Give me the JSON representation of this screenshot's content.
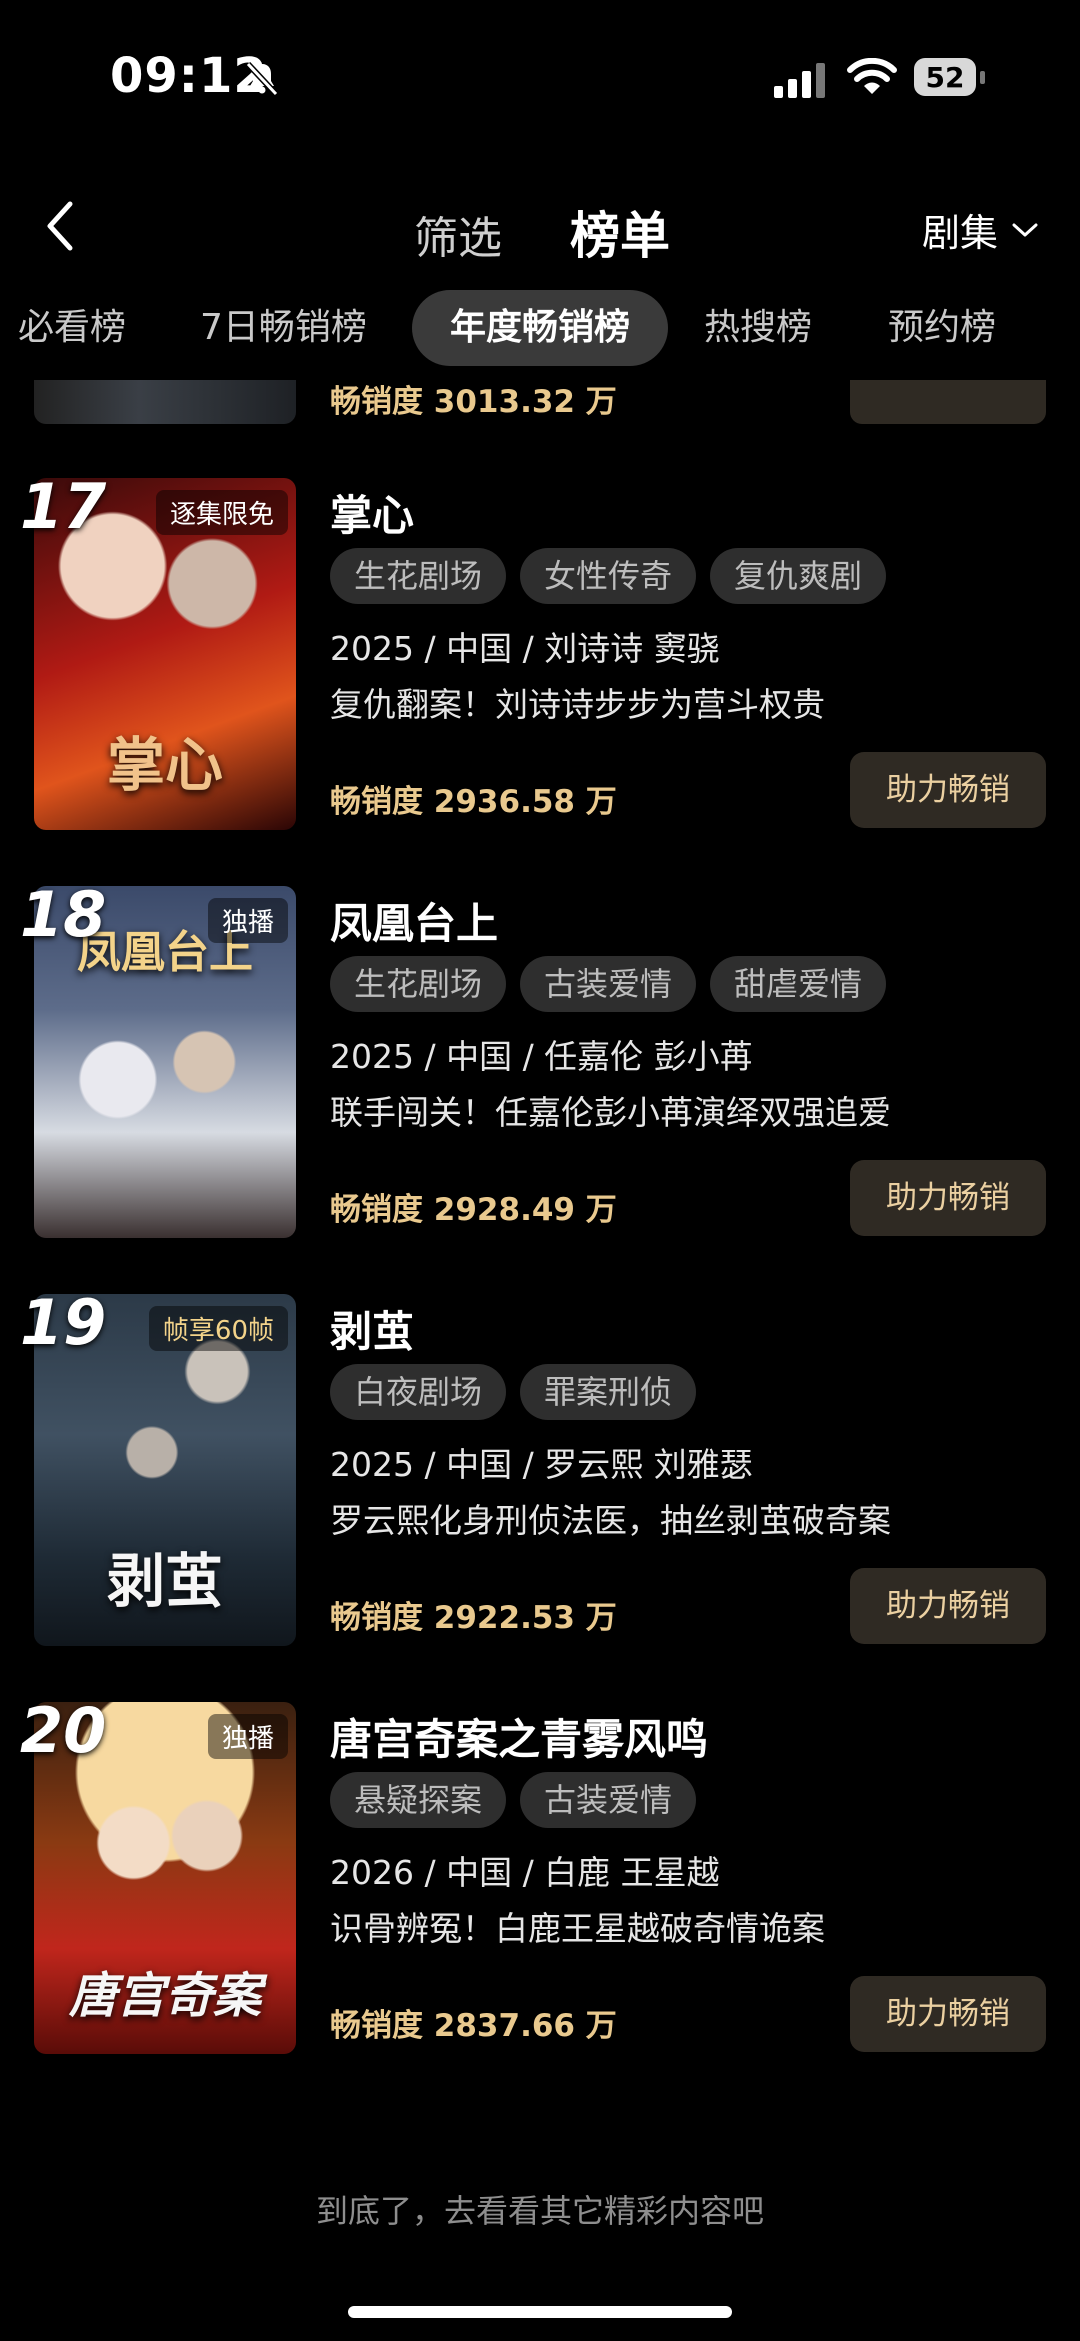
{
  "status": {
    "time": "09:12",
    "battery": "52"
  },
  "nav": {
    "filter_label": "筛选",
    "title": "榜单",
    "dropdown_label": "剧集"
  },
  "tabs": [
    {
      "label": "必看榜",
      "active": false
    },
    {
      "label": "7日畅销榜",
      "active": false
    },
    {
      "label": "年度畅销榜",
      "active": true
    },
    {
      "label": "热搜榜",
      "active": false
    },
    {
      "label": "预约榜",
      "active": false
    }
  ],
  "partial": {
    "sales": "畅销度 3013.32 万"
  },
  "items": [
    {
      "rank": "17",
      "badge": "逐集限免",
      "poster_text": "掌心",
      "title": "掌心",
      "tags": [
        "生花剧场",
        "女性传奇",
        "复仇爽剧"
      ],
      "meta": "2025 / 中国 / 刘诗诗 窦骁",
      "desc": "复仇翻案！刘诗诗步步为营斗权贵",
      "sales": "畅销度 2936.58 万",
      "button": "助力畅销"
    },
    {
      "rank": "18",
      "badge": "独播",
      "poster_text": "凤凰台上",
      "title": "凤凰台上",
      "tags": [
        "生花剧场",
        "古装爱情",
        "甜虐爱情"
      ],
      "meta": "2025 / 中国 / 任嘉伦 彭小苒",
      "desc": "联手闯关！任嘉伦彭小苒演绎双强追爱",
      "sales": "畅销度 2928.49 万",
      "button": "助力畅销"
    },
    {
      "rank": "19",
      "badge": "帧享60帧",
      "poster_text": "剥茧",
      "title": "剥茧",
      "tags": [
        "白夜剧场",
        "罪案刑侦"
      ],
      "meta": "2025 / 中国 / 罗云熙 刘雅瑟",
      "desc": "罗云熙化身刑侦法医，抽丝剥茧破奇案",
      "sales": "畅销度 2922.53 万",
      "button": "助力畅销"
    },
    {
      "rank": "20",
      "badge": "独播",
      "poster_text": "唐宫奇案",
      "title": "唐宫奇案之青雾风鸣",
      "tags": [
        "悬疑探案",
        "古装爱情"
      ],
      "meta": "2026 / 中国 / 白鹿 王星越",
      "desc": "识骨辨冤！白鹿王星越破奇情诡案",
      "sales": "畅销度 2837.66 万",
      "button": "助力畅销"
    }
  ],
  "footer": "到底了，去看看其它精彩内容吧",
  "colors": {
    "background": "#000000",
    "sales_gold": "#e9c98e",
    "button_bg": "#2f2a23",
    "tag_bg": "#2e2e2e"
  }
}
